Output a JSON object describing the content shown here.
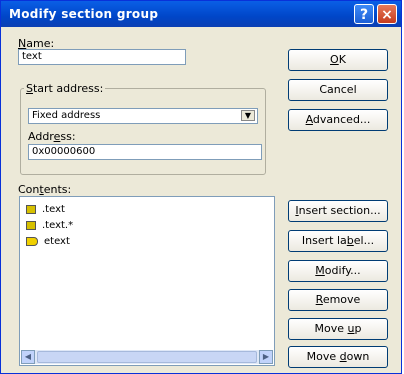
{
  "window": {
    "title": "Modify section group",
    "help_glyph": "?",
    "close_glyph": "×"
  },
  "form": {
    "name_label_key": "N",
    "name_label_rest": "ame:",
    "name_value": "text",
    "start_address_label_key": "S",
    "start_address_label_rest": "tart address:",
    "start_address_value": "Fixed address",
    "address_label_pre": "Addr",
    "address_label_key": "e",
    "address_label_post": "ss:",
    "address_value": "0x00000600",
    "contents_label_pre": "Con",
    "contents_label_key": "t",
    "contents_label_post": "ents:"
  },
  "contents": [
    {
      "label": ".text",
      "icon": "section-icon",
      "icon_color": "#d6c000"
    },
    {
      "label": ".text.*",
      "icon": "section-icon",
      "icon_color": "#d6c000"
    },
    {
      "label": "etext",
      "icon": "label-icon",
      "icon_color": "#f0d000"
    }
  ],
  "buttons": {
    "ok_key": "O",
    "ok_rest": "K",
    "cancel": "Cancel",
    "advanced_key": "A",
    "advanced_rest": "dvanced...",
    "insert_section_key": "I",
    "insert_section_rest": "nsert section...",
    "insert_label_pre": "Insert la",
    "insert_label_key": "b",
    "insert_label_post": "el...",
    "modify_key": "M",
    "modify_rest": "odify...",
    "remove_key": "R",
    "remove_rest": "emove",
    "move_up_pre": "Move ",
    "move_up_key": "u",
    "move_up_post": "p",
    "move_down_pre": "Move ",
    "move_down_key": "d",
    "move_down_post": "own"
  },
  "colors": {
    "titlebar": "#0046c8",
    "dialog_bg": "#ece9d8"
  }
}
